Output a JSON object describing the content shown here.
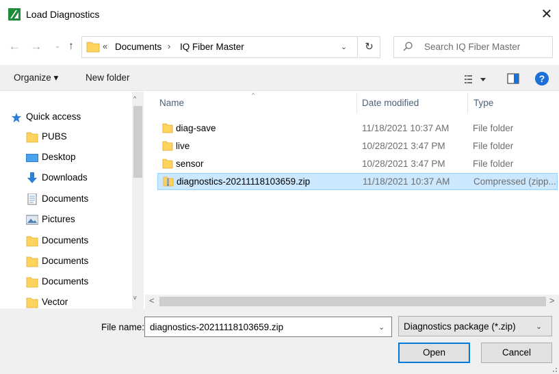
{
  "window": {
    "title": "Load Diagnostics",
    "close_glyph": "✕"
  },
  "nav_buttons": {
    "back": "←",
    "forward": "→",
    "recent": "⌄",
    "up": "↑"
  },
  "address": {
    "chevron": "«",
    "crumbs": [
      "Documents",
      "IQ Fiber Master"
    ],
    "separator": "›",
    "dropdown": "⌄",
    "refresh": "↻"
  },
  "search": {
    "placeholder": "Search IQ Fiber Master"
  },
  "toolbar": {
    "organize_label": "Organize ▾",
    "new_folder_label": "New folder",
    "help_label": "?"
  },
  "nav_pane": {
    "quick_access": "Quick access",
    "items": [
      {
        "label": "PUBS",
        "icon": "folder-icon",
        "pinned": true
      },
      {
        "label": "Desktop",
        "icon": "desktop-icon",
        "pinned": true
      },
      {
        "label": "Downloads",
        "icon": "download-icon",
        "pinned": true
      },
      {
        "label": "Documents",
        "icon": "documents-icon",
        "pinned": true
      },
      {
        "label": "Pictures",
        "icon": "pictures-icon",
        "pinned": true
      },
      {
        "label": "Documents",
        "icon": "folder-icon",
        "pinned": false
      },
      {
        "label": "Documents",
        "icon": "folder-icon",
        "pinned": false
      },
      {
        "label": "Documents",
        "icon": "folder-icon",
        "pinned": false
      },
      {
        "label": "Vector",
        "icon": "folder-icon",
        "pinned": false
      }
    ]
  },
  "file_list": {
    "columns": [
      "Name",
      "Date modified",
      "Type"
    ],
    "sort_indicator": "^",
    "rows": [
      {
        "name": "diag-save",
        "date": "11/18/2021 10:37 AM",
        "type": "File folder",
        "icon": "folder-icon",
        "selected": false
      },
      {
        "name": "live",
        "date": "10/28/2021 3:47 PM",
        "type": "File folder",
        "icon": "folder-icon",
        "selected": false
      },
      {
        "name": "sensor",
        "date": "10/28/2021 3:47 PM",
        "type": "File folder",
        "icon": "folder-icon",
        "selected": false
      },
      {
        "name": "diagnostics-20211118103659.zip",
        "date": "11/18/2021 10:37 AM",
        "type": "Compressed (zipp...",
        "icon": "zip-folder-icon",
        "selected": true
      }
    ]
  },
  "scroll": {
    "left": "<",
    "right": ">",
    "up": "^",
    "down": "v"
  },
  "bottom": {
    "file_name_label": "File name:",
    "file_name_value": "diagnostics-20211118103659.zip",
    "filter_value": "Diagnostics package (*.zip)",
    "dropdown": "⌄",
    "open_label": "Open",
    "cancel_label": "Cancel"
  },
  "colors": {
    "selection": "#cce8ff",
    "selection_border": "#99d1ff",
    "folder": "#ffd45e",
    "accent": "#0078d7",
    "logo_green": "#1e8c3a"
  }
}
